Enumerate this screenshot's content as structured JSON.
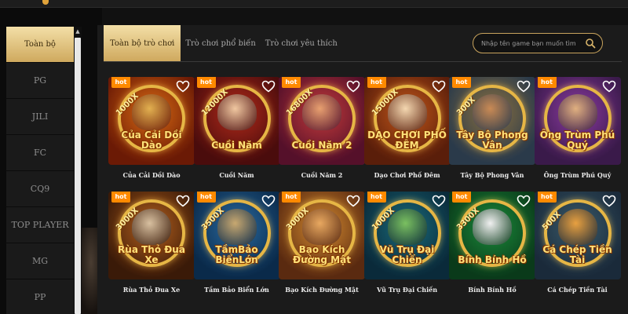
{
  "sidebar": {
    "items": [
      {
        "label": "Toàn bộ",
        "active": true
      },
      {
        "label": "PG"
      },
      {
        "label": "JILI"
      },
      {
        "label": "FC"
      },
      {
        "label": "CQ9"
      },
      {
        "label": "TOP PLAYER"
      },
      {
        "label": "MG"
      },
      {
        "label": "PP"
      }
    ]
  },
  "tabs": [
    {
      "label": "Toàn bộ trò chơi",
      "active": true
    },
    {
      "label": "Trò chơi phổ biến"
    },
    {
      "label": "Trò chơi yêu thích"
    }
  ],
  "search": {
    "placeholder": "Nhập tên game bạn muốn tìm"
  },
  "badge_label": "hot",
  "games": [
    {
      "name": "Của Cải Dồi Dào",
      "logo": "Của Cải Dồi Dào",
      "multiplier": "1000X",
      "colors": [
        "#6b1a05",
        "#d96a13"
      ],
      "mascot": "#e2b050"
    },
    {
      "name": "Cuồi Năm",
      "logo": "Cuồi Năm",
      "multiplier": "12000X",
      "colors": [
        "#4a0c0c",
        "#b12a1a"
      ],
      "mascot": "#f0c7a0"
    },
    {
      "name": "Cuồi Năm 2",
      "logo": "Cuồi Năm 2",
      "multiplier": "16800X",
      "colors": [
        "#55102a",
        "#c23a3a"
      ],
      "mascot": "#e8a070"
    },
    {
      "name": "Dạo Chơi Phố Đêm",
      "logo": "DẠO CHƠI PHỐ ĐÊM",
      "multiplier": "15000X",
      "colors": [
        "#5a1e0a",
        "#c0561a"
      ],
      "mascot": "#f4d7b0"
    },
    {
      "name": "Tây Bộ Phong Vân",
      "logo": "Tây Bộ Phong Vân",
      "multiplier": "300X",
      "colors": [
        "#2a3a4a",
        "#8a7040"
      ],
      "mascot": "#c98a55"
    },
    {
      "name": "Ông Trùm Phú Quý",
      "logo": "Ông Trùm Phú Quý",
      "multiplier": "",
      "colors": [
        "#3a1a4a",
        "#8a3aa0"
      ],
      "mascot": "#e0b080"
    },
    {
      "name": "Rùa Thỏ Đua Xe",
      "logo": "Rùa Thỏ Đua Xe",
      "multiplier": "3000X",
      "colors": [
        "#3a1a08",
        "#b4601e"
      ],
      "mascot": "#d8c0a0"
    },
    {
      "name": "Tầm Bảo Biển Lớn",
      "logo": "TầmBảo BiểnLớn",
      "multiplier": "3500X",
      "colors": [
        "#0a2a4a",
        "#2a6aa0"
      ],
      "mascot": "#c8a870"
    },
    {
      "name": "Bạo Kích Đường Mật",
      "logo": "Bạo Kích Đường Mật",
      "multiplier": "3000X",
      "colors": [
        "#5a2a10",
        "#d48a30"
      ],
      "mascot": "#e8a860"
    },
    {
      "name": "Vũ Trụ Đại Chiến",
      "logo": "Vũ Trụ Đại Chiến",
      "multiplier": "1000X",
      "colors": [
        "#0a2a3a",
        "#1a6a7a"
      ],
      "mascot": "#7ac060"
    },
    {
      "name": "Bính Bính Hồ",
      "logo": "Bính Bính Hồ",
      "multiplier": "3300X",
      "colors": [
        "#0a3a1a",
        "#1a8a3a"
      ],
      "mascot": "#f0f0f0"
    },
    {
      "name": "Cá Chép Tiền Tài",
      "logo": "Cá Chép Tiền Tài",
      "multiplier": "500X",
      "colors": [
        "#1a2a3a",
        "#3a5a6a"
      ],
      "mascot": "#e8a040"
    }
  ]
}
